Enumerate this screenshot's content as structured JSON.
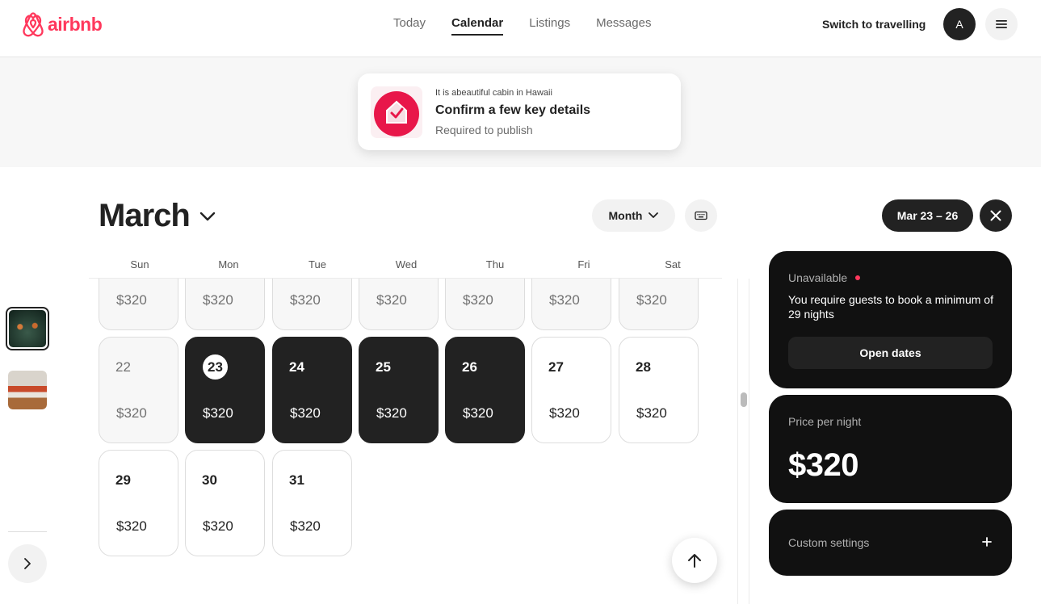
{
  "brand": {
    "name": "airbnb",
    "color": "#FF385C"
  },
  "nav": {
    "items": [
      {
        "label": "Today"
      },
      {
        "label": "Calendar",
        "active": true
      },
      {
        "label": "Listings"
      },
      {
        "label": "Messages"
      }
    ]
  },
  "header": {
    "switch_label": "Switch to travelling",
    "avatar_initial": "A"
  },
  "banner": {
    "kicker": "It is abeautiful cabin in Hawaii",
    "title": "Confirm a few key details",
    "subtitle": "Required to publish"
  },
  "calendar": {
    "month": "March",
    "view_label": "Month",
    "weekdays": [
      "Sun",
      "Mon",
      "Tue",
      "Wed",
      "Thu",
      "Fri",
      "Sat"
    ],
    "rows": [
      [
        {
          "day": "",
          "price": "$320",
          "state": "past"
        },
        {
          "day": "",
          "price": "$320",
          "state": "past"
        },
        {
          "day": "",
          "price": "$320",
          "state": "past"
        },
        {
          "day": "",
          "price": "$320",
          "state": "past"
        },
        {
          "day": "",
          "price": "$320",
          "state": "past"
        },
        {
          "day": "",
          "price": "$320",
          "state": "past"
        },
        {
          "day": "",
          "price": "$320",
          "state": "past"
        }
      ],
      [
        {
          "day": "22",
          "price": "$320",
          "state": "past"
        },
        {
          "day": "23",
          "price": "$320",
          "state": "selected",
          "today": true
        },
        {
          "day": "24",
          "price": "$320",
          "state": "selected"
        },
        {
          "day": "25",
          "price": "$320",
          "state": "selected"
        },
        {
          "day": "26",
          "price": "$320",
          "state": "selected"
        },
        {
          "day": "27",
          "price": "$320",
          "state": "available"
        },
        {
          "day": "28",
          "price": "$320",
          "state": "available"
        }
      ],
      [
        {
          "day": "29",
          "price": "$320",
          "state": "available"
        },
        {
          "day": "30",
          "price": "$320",
          "state": "available"
        },
        {
          "day": "31",
          "price": "$320",
          "state": "available"
        }
      ]
    ]
  },
  "panel": {
    "date_range": "Mar 23 – 26",
    "status": "Unavailable",
    "message": "You require guests to book a minimum of 29 nights",
    "open_dates_label": "Open dates",
    "price_label": "Price per night",
    "price_value": "$320",
    "custom_settings_label": "Custom settings"
  }
}
